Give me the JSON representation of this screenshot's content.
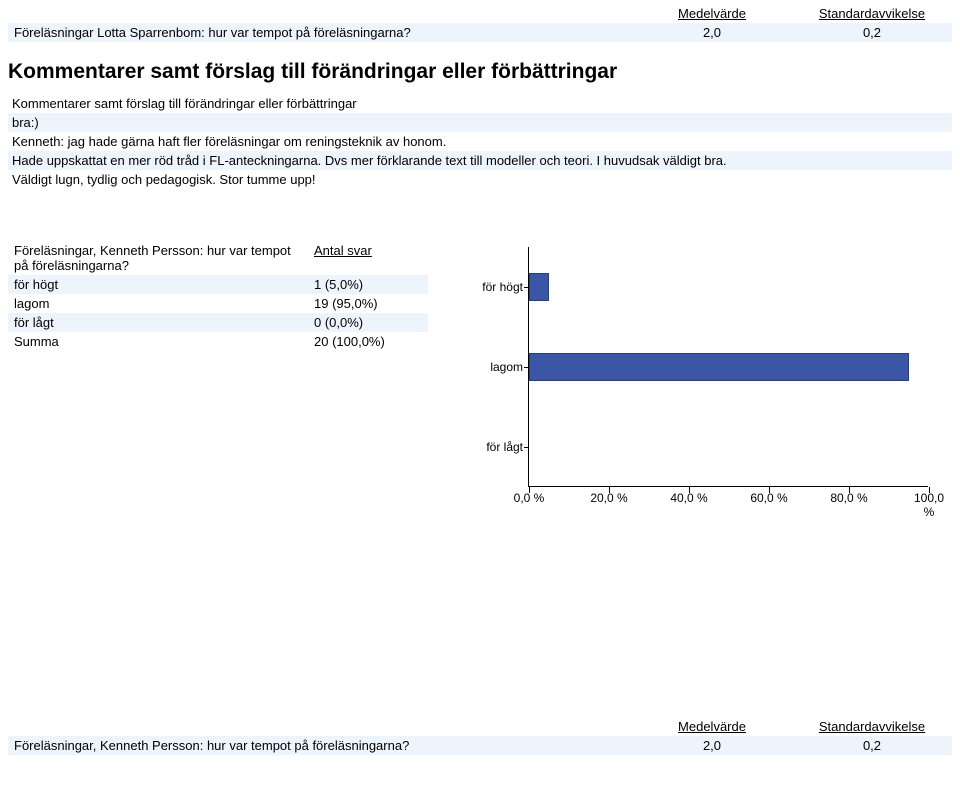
{
  "stats_top": {
    "col_mean": "Medelvärde",
    "col_std": "Standardavvikelse",
    "row_q": "Föreläsningar Lotta Sparrenbom: hur var tempot på föreläsningarna?",
    "row_mean": "2,0",
    "row_std": "0,2"
  },
  "section_heading": "Kommentarer samt förslag till förändringar eller förbättringar",
  "comments": {
    "caption": "Kommentarer samt förslag till förändringar eller förbättringar",
    "line1": "bra:)",
    "line2": "Kenneth: jag hade gärna haft fler föreläsningar om reningsteknik av honom.",
    "line3": "Hade uppskattat en mer röd tråd i FL-anteckningarna. Dvs mer förklarande text till modeller och teori. I huvudsak väldigt bra.",
    "line4": "Väldigt lugn, tydlig och pedagogisk. Stor tumme upp!"
  },
  "freq": {
    "question": "Föreläsningar, Kenneth Persson: hur var tempot på föreläsningarna?",
    "hdr_answers": "Antal svar",
    "rows": {
      "r0_label": "för högt",
      "r0_val": "1 (5,0%)",
      "r1_label": "lagom",
      "r1_val": "19 (95,0%)",
      "r2_label": "för lågt",
      "r2_val": "0 (0,0%)",
      "r3_label": "Summa",
      "r3_val": "20 (100,0%)"
    }
  },
  "chart_data": {
    "type": "bar",
    "orientation": "horizontal",
    "categories": [
      "för högt",
      "lagom",
      "för lågt"
    ],
    "values": [
      5.0,
      95.0,
      0.0
    ],
    "xlim": [
      0,
      100
    ],
    "xticks": [
      "0,0 %",
      "20,0 %",
      "40,0 %",
      "60,0 %",
      "80,0 %",
      "100,0 %"
    ],
    "title": "",
    "xlabel": "",
    "ylabel": ""
  },
  "stats_bottom": {
    "col_mean": "Medelvärde",
    "col_std": "Standardavvikelse",
    "row_q": "Föreläsningar, Kenneth Persson: hur var tempot på föreläsningarna?",
    "row_mean": "2,0",
    "row_std": "0,2"
  }
}
